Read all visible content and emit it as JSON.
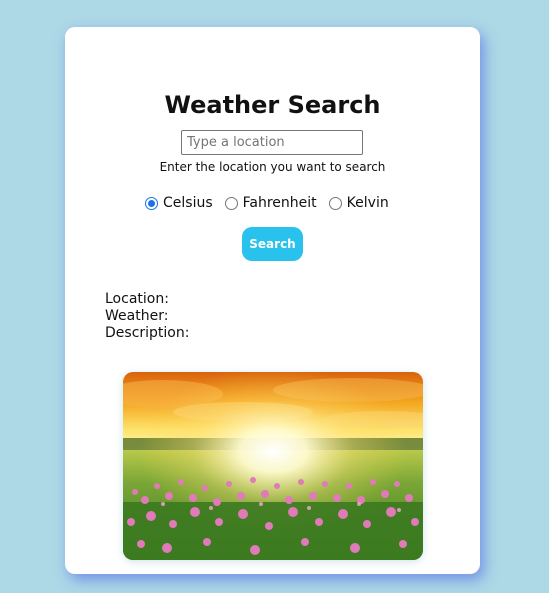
{
  "app": {
    "title": "Weather Search"
  },
  "search": {
    "placeholder": "Type a location",
    "value": "",
    "hint": "Enter the location you want to search",
    "button_label": "Search"
  },
  "units": {
    "options": [
      {
        "label": "Celsius",
        "checked": true
      },
      {
        "label": "Fahrenheit",
        "checked": false
      },
      {
        "label": "Kelvin",
        "checked": false
      }
    ]
  },
  "results": {
    "location_label": "Location:",
    "weather_label": "Weather:",
    "description_label": "Description:"
  },
  "image": {
    "subject": "sunset-meadow-with-pink-flowers"
  },
  "colors": {
    "background": "#add8e6",
    "card": "#ffffff",
    "button": "#29c2ec",
    "radio_accent": "#1a73e8"
  }
}
